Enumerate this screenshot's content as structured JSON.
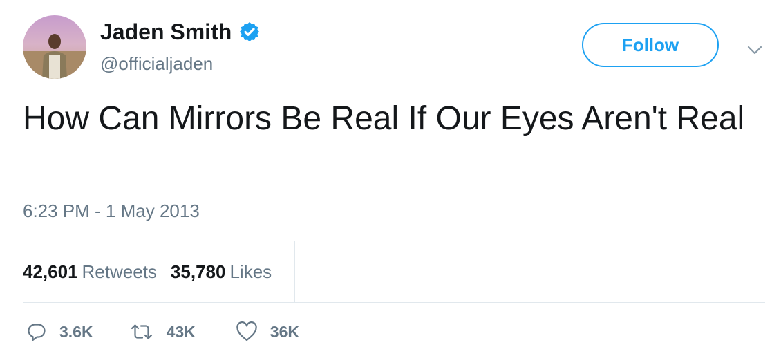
{
  "user": {
    "display_name": "Jaden Smith",
    "handle": "@officialjaden",
    "verified": true,
    "avatar_icon": "profile-photo"
  },
  "follow": {
    "label": "Follow"
  },
  "menu": {
    "icon": "chevron-down-icon"
  },
  "tweet": {
    "text": "How Can Mirrors Be Real If Our Eyes Aren't Real",
    "timestamp": "6:23 PM - 1 May 2013"
  },
  "stats": {
    "retweets_count": "42,601",
    "retweets_label": "Retweets",
    "likes_count": "35,780",
    "likes_label": "Likes"
  },
  "actions": {
    "reply_count": "3.6K",
    "retweet_count": "43K",
    "like_count": "36K"
  },
  "colors": {
    "accent": "#1da1f2",
    "text": "#14171a",
    "secondary": "#657786",
    "border": "#e1e8ed"
  }
}
